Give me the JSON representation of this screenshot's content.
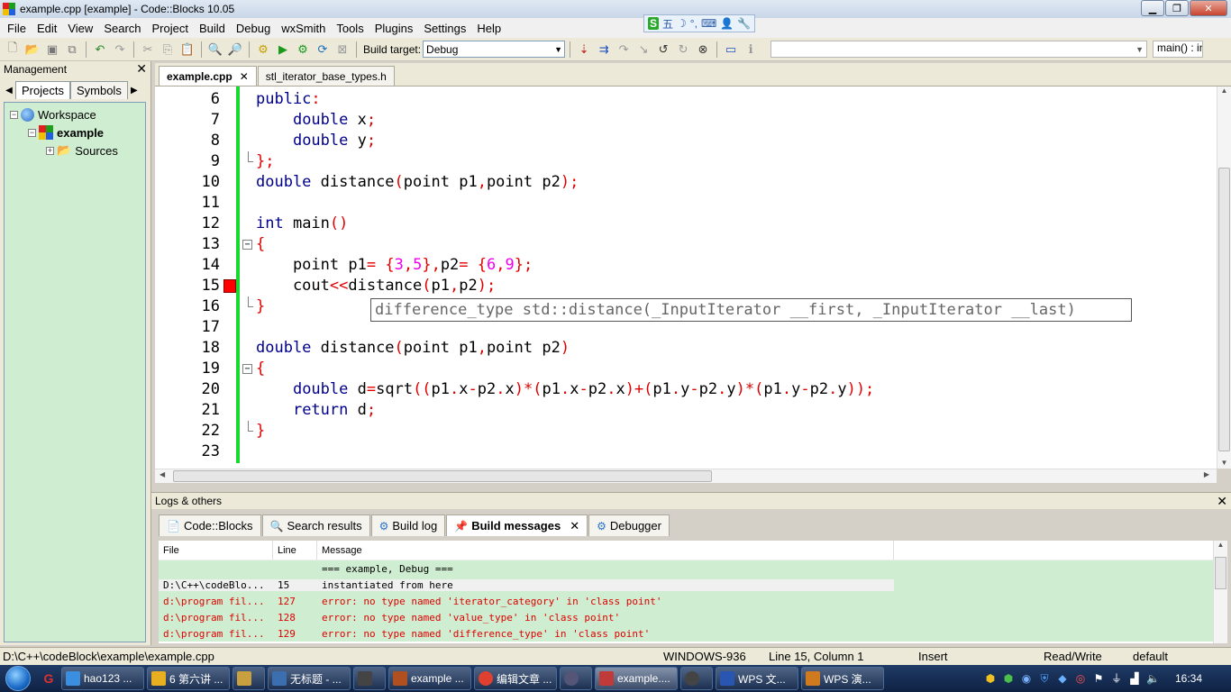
{
  "window": {
    "title": "example.cpp [example] - Code::Blocks 10.05"
  },
  "ime": {
    "items": [
      "S",
      "五",
      "☽",
      "°,",
      "⌨",
      "👤",
      "🔧"
    ]
  },
  "menu": [
    "File",
    "Edit",
    "View",
    "Search",
    "Project",
    "Build",
    "Debug",
    "wxSmith",
    "Tools",
    "Plugins",
    "Settings",
    "Help"
  ],
  "toolbar": {
    "build_target_label": "Build target:",
    "build_target_value": "Debug",
    "function_box": "main() : in"
  },
  "management": {
    "title": "Management",
    "tabs": [
      "Projects",
      "Symbols"
    ],
    "tree": [
      {
        "label": "Workspace",
        "bold": false
      },
      {
        "label": "example",
        "bold": true
      },
      {
        "label": "Sources",
        "bold": false
      }
    ]
  },
  "editor": {
    "tabs": [
      {
        "label": "example.cpp",
        "active": true
      },
      {
        "label": "stl_iterator_base_types.h",
        "active": false
      }
    ],
    "line_numbers": [
      "6",
      "7",
      "8",
      "9",
      "10",
      "11",
      "12",
      "13",
      "14",
      "15",
      "16",
      "17",
      "18",
      "19",
      "20",
      "21",
      "22",
      "23"
    ],
    "calltip": "difference_type std::distance(_InputIterator __first, _InputIterator __last)",
    "error_line": "15"
  },
  "logs": {
    "title": "Logs & others",
    "tabs": [
      "Code::Blocks",
      "Search results",
      "Build log",
      "Build messages",
      "Debugger"
    ],
    "active_tab": "Build messages",
    "columns": [
      "File",
      "Line",
      "Message"
    ],
    "rows": [
      {
        "file": "",
        "line": "",
        "message": "=== example, Debug ===",
        "type": "info"
      },
      {
        "file": "D:\\C++\\codeBlo...",
        "line": "15",
        "message": "instantiated from here",
        "type": "selected"
      },
      {
        "file": "d:\\program fil...",
        "line": "127",
        "message": "error: no type named 'iterator_category' in 'class point'",
        "type": "error"
      },
      {
        "file": "d:\\program fil...",
        "line": "128",
        "message": "error: no type named 'value_type' in 'class point'",
        "type": "error"
      },
      {
        "file": "d:\\program fil...",
        "line": "129",
        "message": "error: no type named 'difference_type' in 'class point'",
        "type": "error"
      }
    ]
  },
  "status": {
    "path": "D:\\C++\\codeBlock\\example\\example.cpp",
    "encoding": "WINDOWS-936",
    "position": "Line 15, Column 1",
    "mode": "Insert",
    "access": "Read/Write",
    "profile": "default"
  },
  "taskbar": {
    "tasks": [
      {
        "label": "hao123 ...",
        "color": "#3a8fe0"
      },
      {
        "label": "6 第六讲 ...",
        "color": "#e8b020"
      },
      {
        "label": "",
        "color": "#c8a040"
      },
      {
        "label": "无标题 - ...",
        "color": "#3c6fb0"
      },
      {
        "label": "",
        "color": "#444"
      },
      {
        "label": "example ...",
        "color": "#b05020"
      },
      {
        "label": "编辑文章 ...",
        "color": "#e04030"
      },
      {
        "label": "",
        "color": "#557"
      },
      {
        "label": "example....",
        "color": "#c03a3a"
      },
      {
        "label": "",
        "color": "#444"
      },
      {
        "label": "WPS 文...",
        "color": "#2856b0"
      },
      {
        "label": "WPS 演...",
        "color": "#d07a20"
      }
    ],
    "clock": "16:34"
  }
}
